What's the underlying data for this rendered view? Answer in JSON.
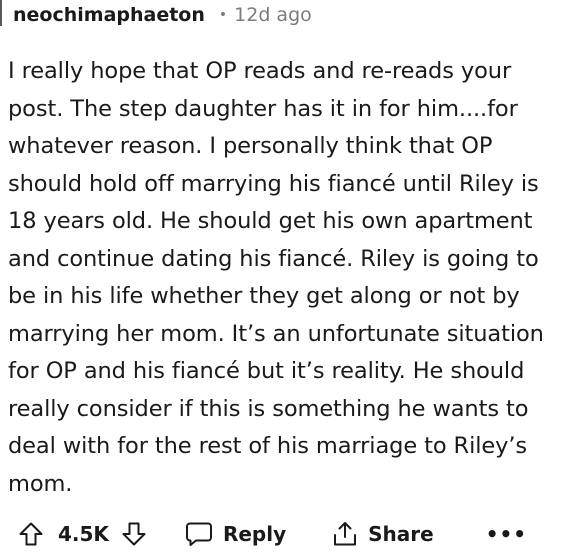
{
  "comment": {
    "author": "neochimaphaeton",
    "separator": "•",
    "age": "12d ago",
    "body": "I really hope that OP reads and re-reads your\npost. The step daughter has it in for him....for\nwhatever reason. I personally think that OP\nshould hold off marrying his fiancé until Riley is\n18 years old. He should get his own apartment\nand continue dating his fiancé. Riley is going to\nbe in his life whether they get along or not by\nmarrying her mom. It’s an unfortunate situation\nfor OP and his fiancé but it’s reality. He should\nreally consider if this is something he wants to\ndeal with for the rest of his marriage to Riley’s\nmom."
  },
  "actions": {
    "vote_count": "4.5K",
    "reply_label": "Reply",
    "share_label": "Share",
    "more_label": "•••",
    "icons": {
      "upvote": "upvote-arrow-icon",
      "downvote": "downvote-arrow-icon",
      "reply": "speech-bubble-icon",
      "share": "share-upload-icon"
    }
  }
}
